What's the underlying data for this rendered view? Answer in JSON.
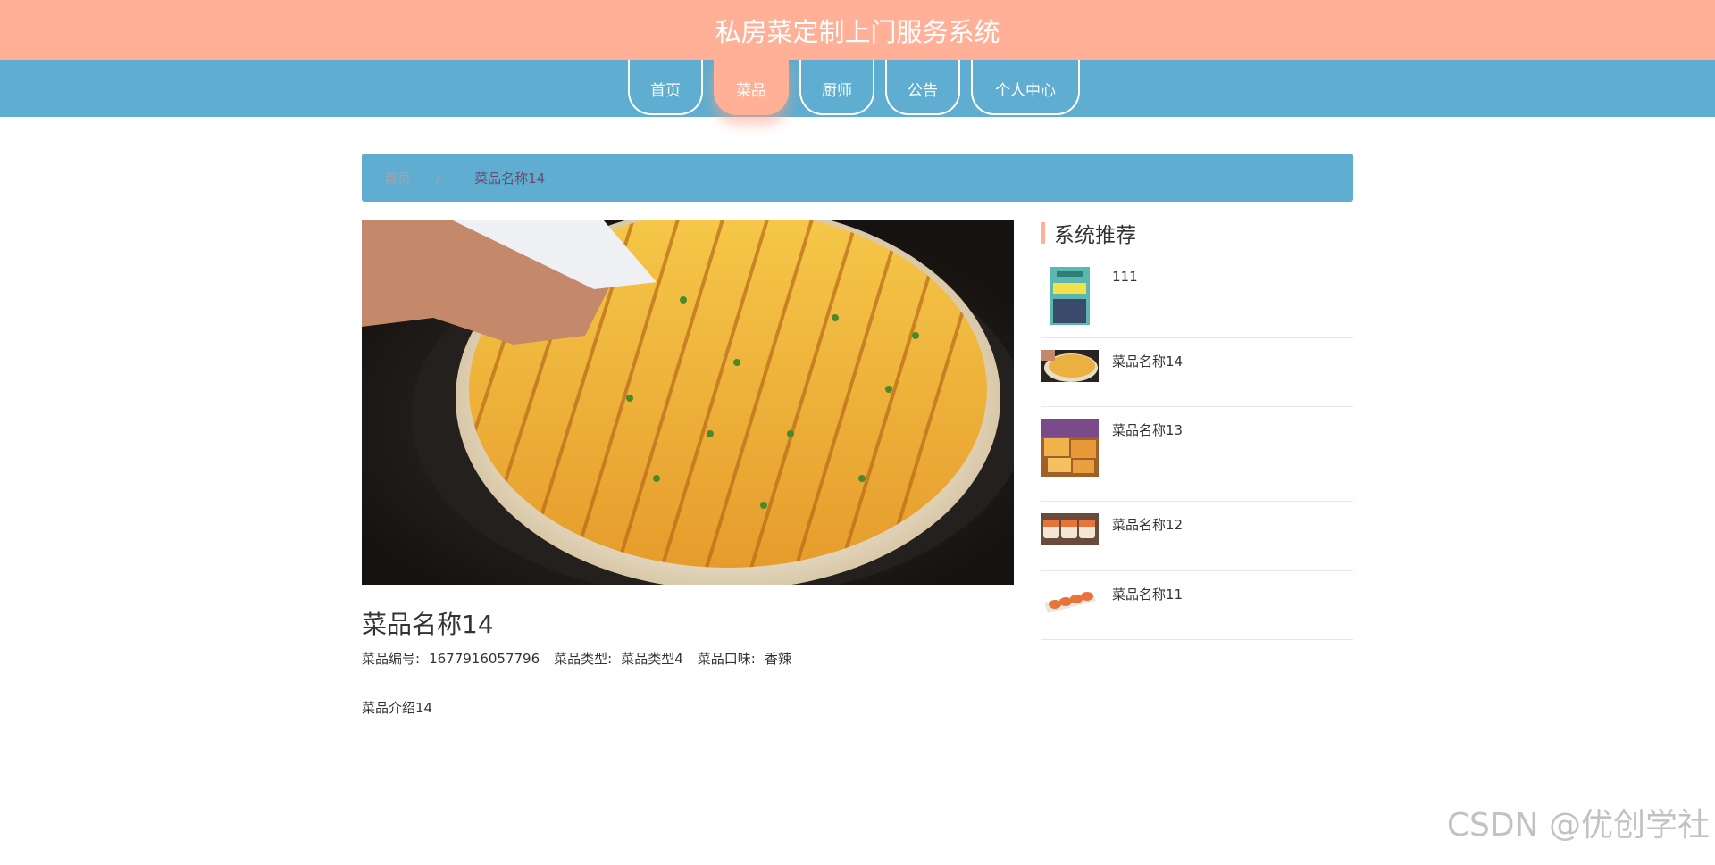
{
  "header": {
    "site_title": "私房菜定制上门服务系统"
  },
  "nav": {
    "items": [
      {
        "label": "首页",
        "active": false
      },
      {
        "label": "菜品",
        "active": true
      },
      {
        "label": "厨师",
        "active": false
      },
      {
        "label": "公告",
        "active": false
      },
      {
        "label": "个人中心",
        "active": false
      }
    ]
  },
  "breadcrumb": {
    "home": "首页",
    "separator": "/",
    "current": "菜品名称14"
  },
  "dish": {
    "title": "菜品名称14",
    "meta": [
      {
        "label": "菜品编号:",
        "value": "1677916057796"
      },
      {
        "label": "菜品类型:",
        "value": "菜品类型4"
      },
      {
        "label": "菜品口味:",
        "value": "香辣"
      }
    ],
    "description": "菜品介绍14"
  },
  "sidebar": {
    "title": "系统推荐",
    "items": [
      {
        "name": "111"
      },
      {
        "name": "菜品名称14"
      },
      {
        "name": "菜品名称13"
      },
      {
        "name": "菜品名称12"
      },
      {
        "name": "菜品名称11"
      }
    ]
  },
  "watermark": "CSDN @优创学社",
  "colors": {
    "header": "#ffb096",
    "nav": "#5fadd0",
    "accent": "#ffb096"
  }
}
